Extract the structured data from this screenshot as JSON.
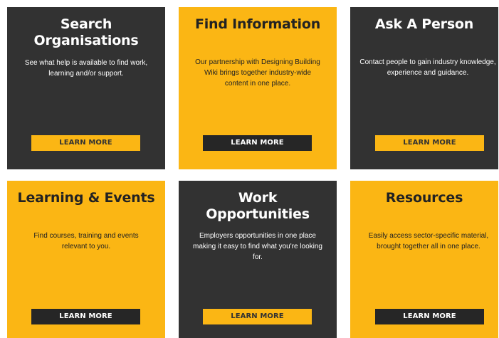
{
  "colors": {
    "dark": "#323232",
    "yellow": "#fbb614",
    "button_dark": "#262626",
    "text_light": "#ffffff"
  },
  "cards": [
    {
      "title": "Search\nOrganisations",
      "description": "See what help is available to find work, learning and/or support.",
      "button": "LEARN MORE",
      "theme": "dark"
    },
    {
      "title": "Find Information",
      "description": "Our partnership with Designing Building Wiki brings together industry-wide content in one place.",
      "button": "LEARN MORE",
      "theme": "yellow"
    },
    {
      "title": "Ask A Person",
      "description": "Contact people to gain industry knowledge, experience and guidance.",
      "button": "LEARN MORE",
      "theme": "dark"
    },
    {
      "title": "Learning & Events",
      "description": "Find courses, training and events relevant to you.",
      "button": "LEARN MORE",
      "theme": "yellow"
    },
    {
      "title": "Work\nOpportunities",
      "description": "Employers opportunities in one place making it easy to find what you're looking for.",
      "button": "LEARN MORE",
      "theme": "dark"
    },
    {
      "title": "Resources",
      "description": "Easily access sector-specific material, brought together all in one place.",
      "button": "LEARN MORE",
      "theme": "yellow"
    }
  ]
}
